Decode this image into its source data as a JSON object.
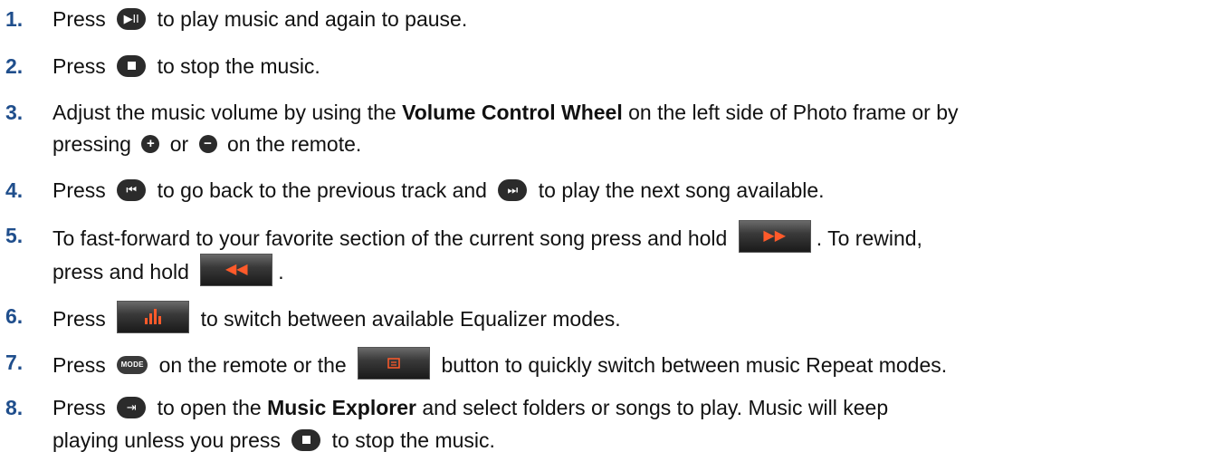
{
  "items": [
    {
      "num": "1.",
      "a": "Press",
      "b": "to play music and again to pause."
    },
    {
      "num": "2.",
      "a": "Press",
      "b": "to stop the music."
    },
    {
      "num": "3.",
      "a": "Adjust the music volume by using the",
      "bold": "Volume Control Wheel",
      "b": "on the left side of Photo frame or by",
      "c": "pressing",
      "d": "or",
      "e": "on the remote."
    },
    {
      "num": "4.",
      "a": "Press",
      "b": "to go back to the previous track and",
      "c": "to play the next song available."
    },
    {
      "num": "5.",
      "a": "To fast-forward to your favorite section of the current song press and hold",
      "b": ". To rewind,",
      "c": "press and hold",
      "d": "."
    },
    {
      "num": "6.",
      "a": "Press",
      "b": "to switch between available Equalizer modes."
    },
    {
      "num": "7.",
      "a": "Press",
      "b": "on the remote or the",
      "c": "button to quickly switch between music Repeat modes."
    },
    {
      "num": "8.",
      "a": "Press",
      "b": "to open the",
      "bold": "Music Explorer",
      "c": "and select folders or songs to play. Music will keep",
      "d": "playing unless you press",
      "e": "to stop the music."
    }
  ],
  "icons": {
    "play_pause": "▶II",
    "vol_up": "+",
    "vol_down": "−",
    "prev": "⏮",
    "next": "⏭",
    "ff": "▶▶",
    "rw": "◀◀",
    "mode": "MODE",
    "explorer": "⇥"
  }
}
